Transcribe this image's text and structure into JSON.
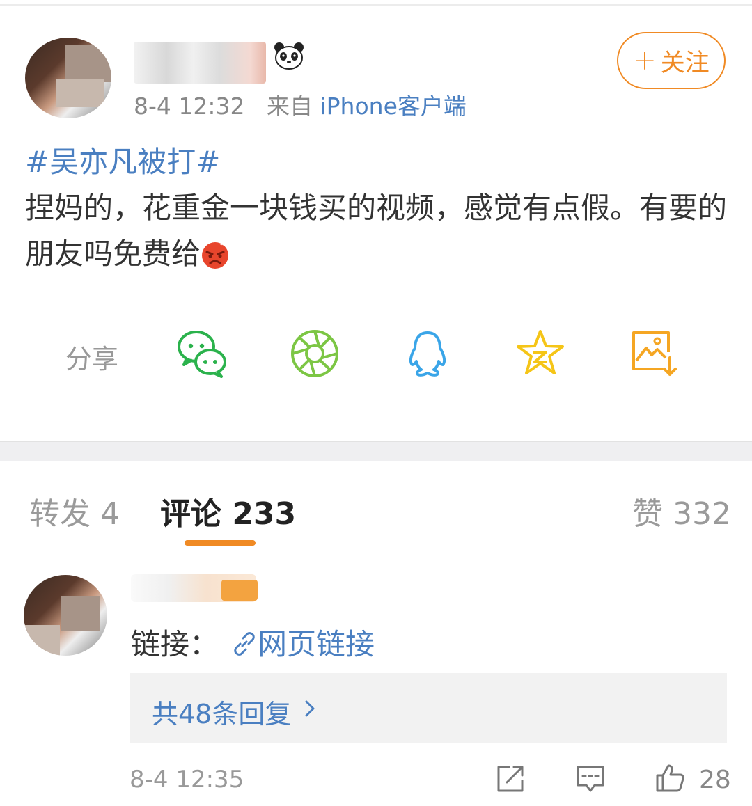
{
  "post": {
    "time": "8-4 12:32",
    "source_prefix": "来自",
    "source": "iPhone客户端",
    "follow_label": "关注",
    "topic": "#吴亦凡被打#",
    "text": "捏妈的，花重金一块钱买的视频，感觉有点假。有要的朋友吗免费给"
  },
  "share": {
    "label": "分享",
    "icons": [
      "wechat-icon",
      "moments-icon",
      "qq-icon",
      "qzone-icon",
      "save-image-icon"
    ]
  },
  "tabs": {
    "repost": "转发 4",
    "comment": "评论 233",
    "like": "赞 332"
  },
  "comment": {
    "prefix": "链接：",
    "link_label": "网页链接",
    "replies_label": "共48条回复",
    "time": "8-4 12:35",
    "likes": "28"
  },
  "colors": {
    "accent": "#f08a24",
    "link": "#4a7fc1",
    "wechat": "#2bb24c",
    "moments": "#7cc644",
    "qq": "#3aa5e8",
    "qzone": "#f5c517"
  }
}
